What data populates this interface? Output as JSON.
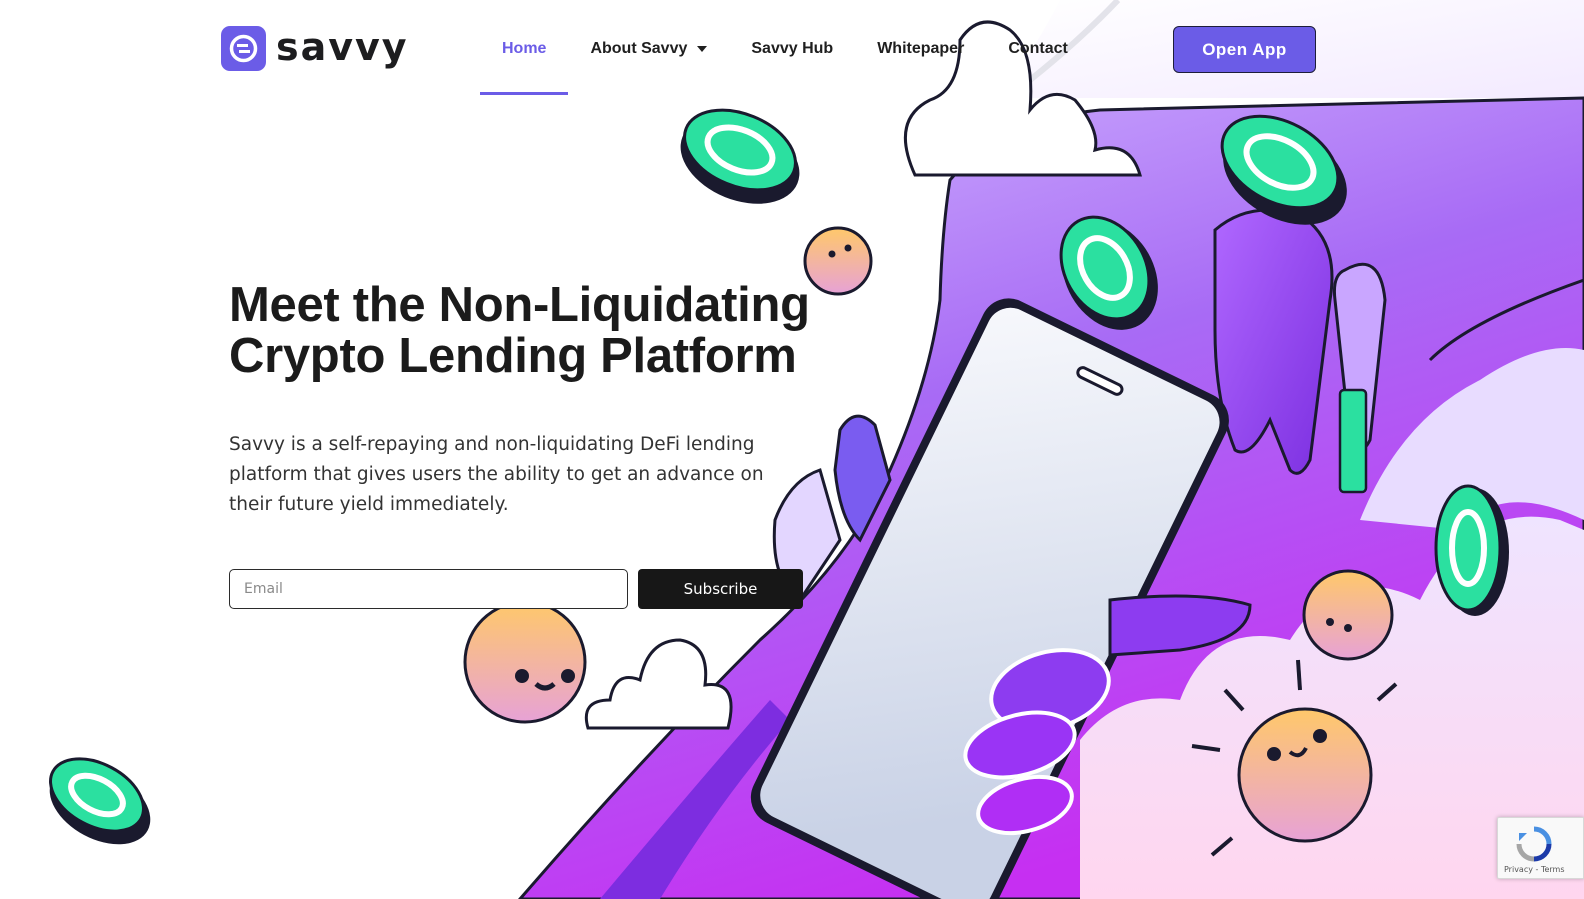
{
  "brand": {
    "name": "savvy",
    "accent": "#6b5ce7",
    "icon": "savvy-logo-icon"
  },
  "nav": {
    "items": [
      {
        "label": "Home",
        "active": true
      },
      {
        "label": "About Savvy",
        "dropdown": true
      },
      {
        "label": "Savvy Hub"
      },
      {
        "label": "Whitepaper"
      },
      {
        "label": "Contact"
      }
    ],
    "cta": "Open App"
  },
  "hero": {
    "title_line1": "Meet the Non-Liquidating",
    "title_line2": "Crypto Lending Platform",
    "description": "Savvy is a self-repaying and non-liquidating DeFi lending platform that gives users the ability to get an advance on their future yield immediately."
  },
  "subscribe_form": {
    "email_placeholder": "Email",
    "button_label": "Subscribe"
  },
  "recaptcha": {
    "links": "Privacy - Terms",
    "icon": "recaptcha-icon"
  },
  "colors": {
    "purple_light": "#c9a6ff",
    "purple": "#9b4dff",
    "magenta": "#c62ff2",
    "coin_green": "#2be0a0",
    "dark": "#171717"
  }
}
